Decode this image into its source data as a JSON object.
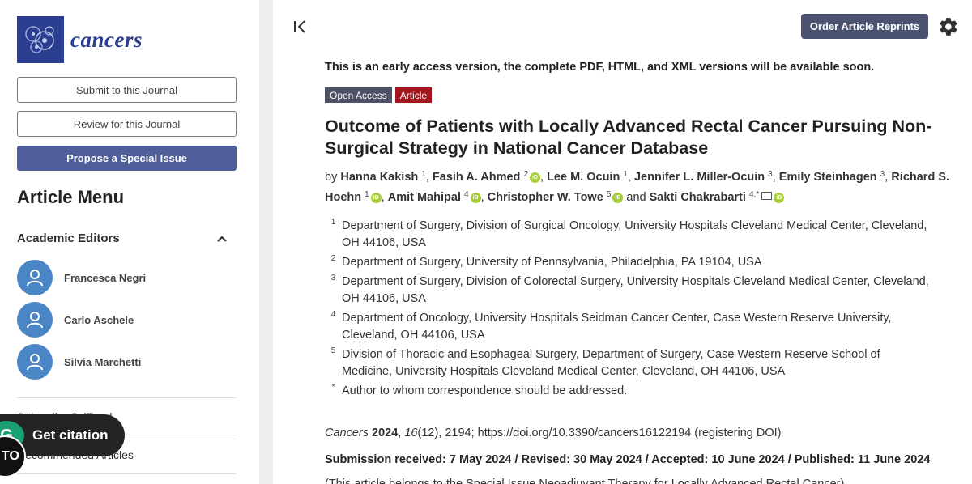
{
  "sidebar": {
    "logo_text": "cancers",
    "buttons": {
      "submit": "Submit to this Journal",
      "review": "Review for this Journal",
      "propose": "Propose a Special Issue"
    },
    "menu_title": "Article Menu",
    "editors_heading": "Academic Editors",
    "editors": [
      {
        "name": "Francesca Negri"
      },
      {
        "name": "Carlo Aschele"
      },
      {
        "name": "Silvia Marchetti"
      }
    ],
    "links": {
      "subscribe": "Subscribe SciFeed",
      "recommended": "Recommended Articles"
    },
    "get_citation": "Get citation",
    "badge_letter": "G",
    "circle_text": "TO"
  },
  "header": {
    "order_reprints": "Order Article Reprints"
  },
  "article": {
    "notice": "This is an early access version, the complete PDF, HTML, and XML versions will be available soon.",
    "badges": {
      "open_access": "Open Access",
      "type": "Article"
    },
    "title": "Outcome of Patients with Locally Advanced Rectal Cancer Pursuing Non-Surgical Strategy in National Cancer Database",
    "by": "by",
    "and": "and",
    "authors": [
      {
        "name": "Hanna Kakish",
        "sup": "1"
      },
      {
        "name": "Fasih A. Ahmed",
        "sup": "2"
      },
      {
        "name": "Lee M. Ocuin",
        "sup": "1"
      },
      {
        "name": "Jennifer L. Miller-Ocuin",
        "sup": "3"
      },
      {
        "name": "Emily Steinhagen",
        "sup": "3"
      },
      {
        "name": "Richard S. Hoehn",
        "sup": "1"
      },
      {
        "name": "Amit Mahipal",
        "sup": "4"
      },
      {
        "name": "Christopher W. Towe",
        "sup": "5"
      },
      {
        "name": "Sakti Chakrabarti",
        "sup": "4,*"
      }
    ],
    "affiliations": [
      {
        "num": "1",
        "text": "Department of Surgery, Division of Surgical Oncology, University Hospitals Cleveland Medical Center, Cleveland, OH 44106, USA"
      },
      {
        "num": "2",
        "text": "Department of Surgery, University of Pennsylvania, Philadelphia, PA 19104, USA"
      },
      {
        "num": "3",
        "text": "Department of Surgery, Division of Colorectal Surgery, University Hospitals Cleveland Medical Center, Cleveland, OH 44106, USA"
      },
      {
        "num": "4",
        "text": "Department of Oncology, University Hospitals Seidman Cancer Center, Case Western Reserve University, Cleveland, OH 44106, USA"
      },
      {
        "num": "5",
        "text": "Division of Thoracic and Esophageal Surgery, Department of Surgery, Case Western Reserve School of Medicine, University Hospitals Cleveland Medical Center, Cleveland, OH 44106, USA"
      },
      {
        "num": "*",
        "text": "Author to whom correspondence should be addressed."
      }
    ],
    "citation": {
      "journal": "Cancers",
      "year": "2024",
      "volume": "16",
      "rest": "(12), 2194; https://doi.org/10.3390/cancers16122194 (registering DOI)"
    },
    "dates": "Submission received: 7 May 2024 / Revised: 30 May 2024 / Accepted: 10 June 2024 / Published: 11 June 2024",
    "special_issue": "(This article belongs to the Special Issue Neoadjuvant Therapy for Locally Advanced Rectal Cancer)"
  },
  "colors": {
    "brand": "#2b3e8f",
    "primary_button": "#4f5f9c",
    "article_badge": "#a3161e",
    "orcid": "#a6ce39"
  }
}
